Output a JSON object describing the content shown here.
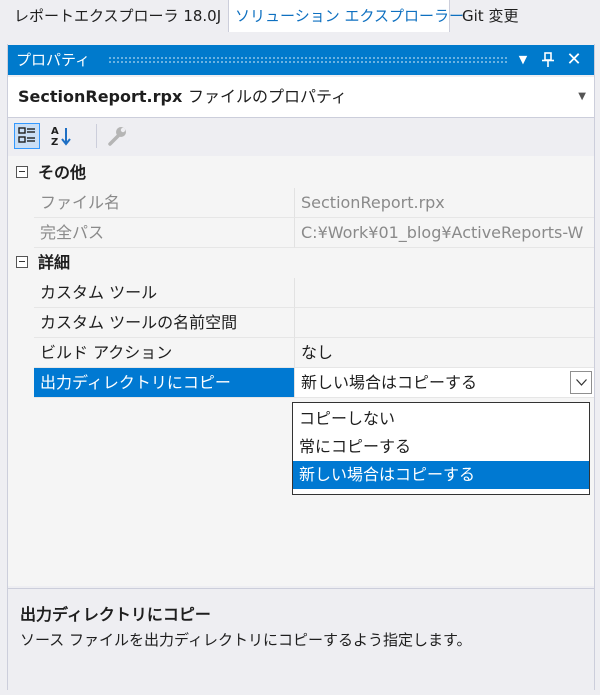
{
  "tabs": [
    {
      "label": "レポートエクスプローラ 18.0J"
    },
    {
      "label": "ソリューション エクスプローラー"
    },
    {
      "label": "Git 変更"
    }
  ],
  "window": {
    "title": "プロパティ",
    "buttons": {
      "dropdown": "▼",
      "pin": "╨",
      "close": "✕"
    }
  },
  "object_selector": {
    "name": "SectionReport.rpx",
    "kind": "ファイルのプロパティ"
  },
  "toolbar": {
    "icons": [
      "categorized-icon",
      "alphabetical-icon",
      "property-pages-icon"
    ]
  },
  "grid": {
    "categories": [
      {
        "label": "その他"
      },
      {
        "label": "詳細"
      }
    ],
    "rows": [
      {
        "name": "ファイル名",
        "value": "SectionReport.rpx"
      },
      {
        "name": "完全パス",
        "value": "C:¥Work¥01_blog¥ActiveReports-W"
      },
      {
        "name": "カスタム ツール",
        "value": ""
      },
      {
        "name": "カスタム ツールの名前空間",
        "value": ""
      },
      {
        "name": "ビルド アクション",
        "value": "なし"
      },
      {
        "name": "出力ディレクトリにコピー",
        "value": "新しい場合はコピーする"
      }
    ]
  },
  "dropdown": {
    "options": [
      "コピーしない",
      "常にコピーする",
      "新しい場合はコピーする"
    ],
    "selected": "新しい場合はコピーする"
  },
  "description": {
    "title": "出力ディレクトリにコピー",
    "text": "ソース ファイルを出力ディレクトリにコピーするよう指定します。"
  },
  "colors": {
    "accent": "#007acc",
    "selection": "#0079d2",
    "readonly_text": "#8a8a8a"
  }
}
